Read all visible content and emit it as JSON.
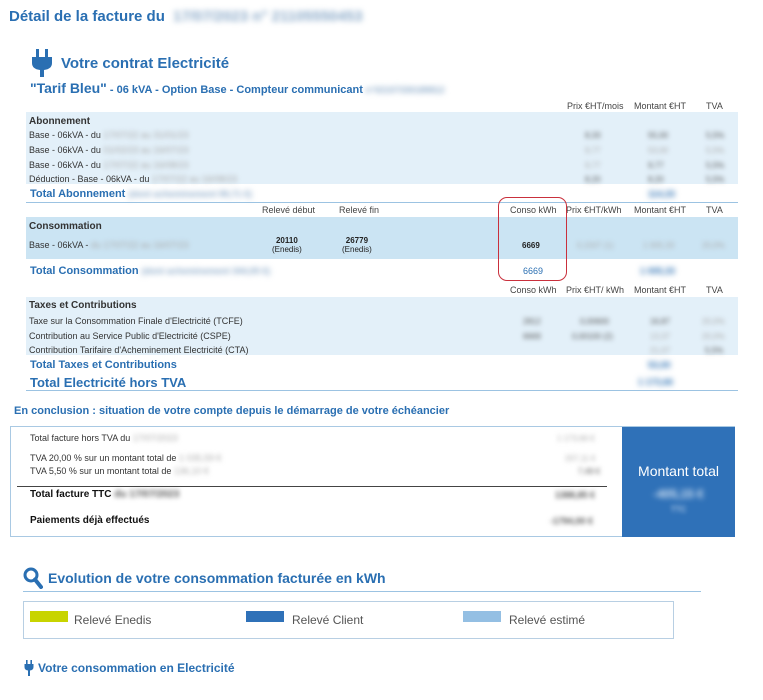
{
  "header": {
    "title": "Détail de la facture du",
    "title_redacted": "17/07/2023 n° 21105550453"
  },
  "contract": {
    "title": "Votre contrat Electricité",
    "tarif_name": "\"Tarif Bleu\"",
    "tarif_details": " - 06 kVA - Option Base - Compteur communicant",
    "meter_redacted": " n°02107330189812"
  },
  "abonnement": {
    "col_price": "Prix €HT/mois",
    "col_amount": "Montant €HT",
    "col_tva": "TVA",
    "section_title": "Abonnement",
    "rows": [
      {
        "label": "Base - 06kVA - du",
        "period": "17/07/22 au 31/01/23",
        "price": "8,33",
        "amount": "55,00",
        "tva": "5,5%"
      },
      {
        "label": "Base - 06kVA - du",
        "period": "01/02/23 au 16/07/23",
        "price": "9,77",
        "amount": "53,00",
        "tva": "5,5%"
      },
      {
        "label": "Base - 06kVA - du",
        "period": "17/07/22 au 16/08/23",
        "price": "9,77",
        "amount": "9,77",
        "tva": "5,5%"
      },
      {
        "label": "Déduction - Base - 06kVA - du",
        "period": "17/07/22 au 16/08/23",
        "price": "8,20",
        "amount": "8,20",
        "tva": "5,5%"
      }
    ],
    "total_label": "Total Abonnement",
    "total_note": "(dont acheminement 99,71 €)",
    "total_value": "114,33"
  },
  "consommation": {
    "col_releve_debut": "Relevé début",
    "col_releve_fin": "Relevé fin",
    "col_conso": "Conso kWh",
    "col_price": "Prix €HT/kWh",
    "col_amount": "Montant €HT",
    "col_tva": "TVA",
    "section_title": "Consommation",
    "row_label": "Base - 06kVA -",
    "row_period": "du 17/07/22 au 16/07/23",
    "releve_debut": "20110",
    "releve_debut_src": "(Enedis)",
    "releve_fin": "26779",
    "releve_fin_src": "(Enedis)",
    "conso": "6669",
    "price": "0,1507 (1)",
    "amount": "1 005,33",
    "tva": "20,0%",
    "total_label": "Total Consommation",
    "total_note": "(dont acheminement 344,05 €)",
    "total_conso": "6669",
    "total_value": "1 005,33"
  },
  "taxes": {
    "col_conso": "Conso kWh",
    "col_price": "Prix €HT/ kWh",
    "col_amount": "Montant €HT",
    "col_tva": "TVA",
    "section_title": "Taxes et Contributions",
    "rows": [
      {
        "label": "Taxe sur la Consommation Finale d'Electricité (TCFE)",
        "conso": "2812",
        "price": "0,00600",
        "amount": "16,87",
        "tva": "20,0%"
      },
      {
        "label": "Contribution au Service Public d'Electricité (CSPE)",
        "conso": "6669",
        "price": "0,00100 (2)",
        "amount": "13,37",
        "tva": "20,0%"
      },
      {
        "label": "Contribution Tarifaire d'Acheminement Electricité (CTA)",
        "conso": "",
        "price": "",
        "amount": "21,07",
        "tva": "5,5%"
      }
    ],
    "total_label": "Total Taxes et Contributions",
    "total_value": "53,00",
    "grand_total_label": "Total Electricité hors TVA",
    "grand_total_value": "1 173,66"
  },
  "conclusion": {
    "title": "En conclusion : situation de votre compte depuis le démarrage de votre échéancier",
    "line1_label": "Total facture hors TVA du",
    "line1_date": "17/07/2023",
    "line1_value": "1 173,66 €",
    "line2_label": "TVA 20,00 % sur un montant total de",
    "line2_base": "1 035,59 €",
    "line2_value": "207,11 €",
    "line3_label": "TVA 5,50 % sur un montant total de",
    "line3_base": "136,10 €",
    "line3_value": "7,49 €",
    "ttc_label": "Total facture TTC",
    "ttc_date": "du 17/07/2023",
    "ttc_value": "1388,85 €",
    "paid_label": "Paiements déjà effectués",
    "paid_value": "-1794,00 €",
    "montant_label": "Montant total",
    "montant_value": "-405,15 €",
    "montant_sub": "TTC"
  },
  "evolution": {
    "title": "Evolution de votre consommation facturée en kWh",
    "legend": [
      {
        "label": "Relevé Enedis",
        "color": "#c8d400"
      },
      {
        "label": "Relevé Client",
        "color": "#2f71b8"
      },
      {
        "label": "Relevé estimé",
        "color": "#94bfe3"
      }
    ]
  },
  "electricity_section": {
    "title": "Votre consommation en Electricité"
  },
  "colors": {
    "accent": "#2a6fb2",
    "band": "#e3f0f9",
    "band_dark": "#cbe4f3",
    "highlight_circle": "#c9303c",
    "montant_bg": "#2f71b8"
  },
  "icons": [
    "plug-icon",
    "magnifier-icon",
    "small-plug-icon"
  ]
}
